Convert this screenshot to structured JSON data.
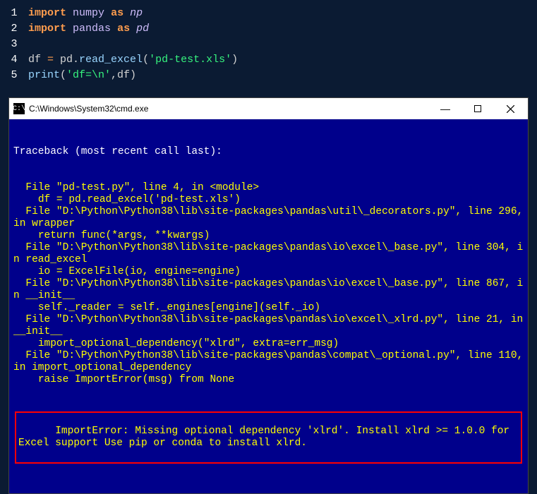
{
  "editor": {
    "lines": [
      {
        "n": "1",
        "tokens": [
          [
            "kw",
            "import"
          ],
          [
            "",
            " "
          ],
          [
            "mod",
            "numpy"
          ],
          [
            "",
            " "
          ],
          [
            "kw",
            "as"
          ],
          [
            "",
            " "
          ],
          [
            "mod id",
            "np"
          ]
        ]
      },
      {
        "n": "2",
        "tokens": [
          [
            "kw",
            "import"
          ],
          [
            "",
            " "
          ],
          [
            "mod",
            "pandas"
          ],
          [
            "",
            " "
          ],
          [
            "kw",
            "as"
          ],
          [
            "",
            " "
          ],
          [
            "mod id",
            "pd"
          ]
        ]
      },
      {
        "n": "3",
        "tokens": [
          [
            "",
            ""
          ]
        ]
      },
      {
        "n": "4",
        "tokens": [
          [
            "",
            "df "
          ],
          [
            "op",
            "="
          ],
          [
            "",
            " pd."
          ],
          [
            "fn",
            "read_excel"
          ],
          [
            "",
            "("
          ],
          [
            "str",
            "'pd-test.xls'"
          ],
          [
            "",
            ")"
          ]
        ]
      },
      {
        "n": "5",
        "tokens": [
          [
            "fn",
            "print"
          ],
          [
            "",
            "("
          ],
          [
            "str",
            "'df=\\n'"
          ],
          [
            "",
            ",df)"
          ]
        ]
      }
    ]
  },
  "cmd": {
    "title": "C:\\Windows\\System32\\cmd.exe",
    "min": "—",
    "traceback_header": "Traceback (most recent call last):",
    "lines": [
      "  File \"pd-test.py\", line 4, in <module>",
      "    df = pd.read_excel('pd-test.xls')",
      "  File \"D:\\Python\\Python38\\lib\\site-packages\\pandas\\util\\_decorators.py\", line 296, in wrapper",
      "    return func(*args, **kwargs)",
      "  File \"D:\\Python\\Python38\\lib\\site-packages\\pandas\\io\\excel\\_base.py\", line 304, in read_excel",
      "    io = ExcelFile(io, engine=engine)",
      "  File \"D:\\Python\\Python38\\lib\\site-packages\\pandas\\io\\excel\\_base.py\", line 867, in __init__",
      "    self._reader = self._engines[engine](self._io)",
      "  File \"D:\\Python\\Python38\\lib\\site-packages\\pandas\\io\\excel\\_xlrd.py\", line 21, in __init__",
      "    import_optional_dependency(\"xlrd\", extra=err_msg)",
      "  File \"D:\\Python\\Python38\\lib\\site-packages\\pandas\\compat\\_optional.py\", line 110, in import_optional_dependency",
      "    raise ImportError(msg) from None"
    ],
    "error": "ImportError: Missing optional dependency 'xlrd'. Install xlrd >= 1.0.0 for Excel support Use pip or conda to install xlrd."
  }
}
